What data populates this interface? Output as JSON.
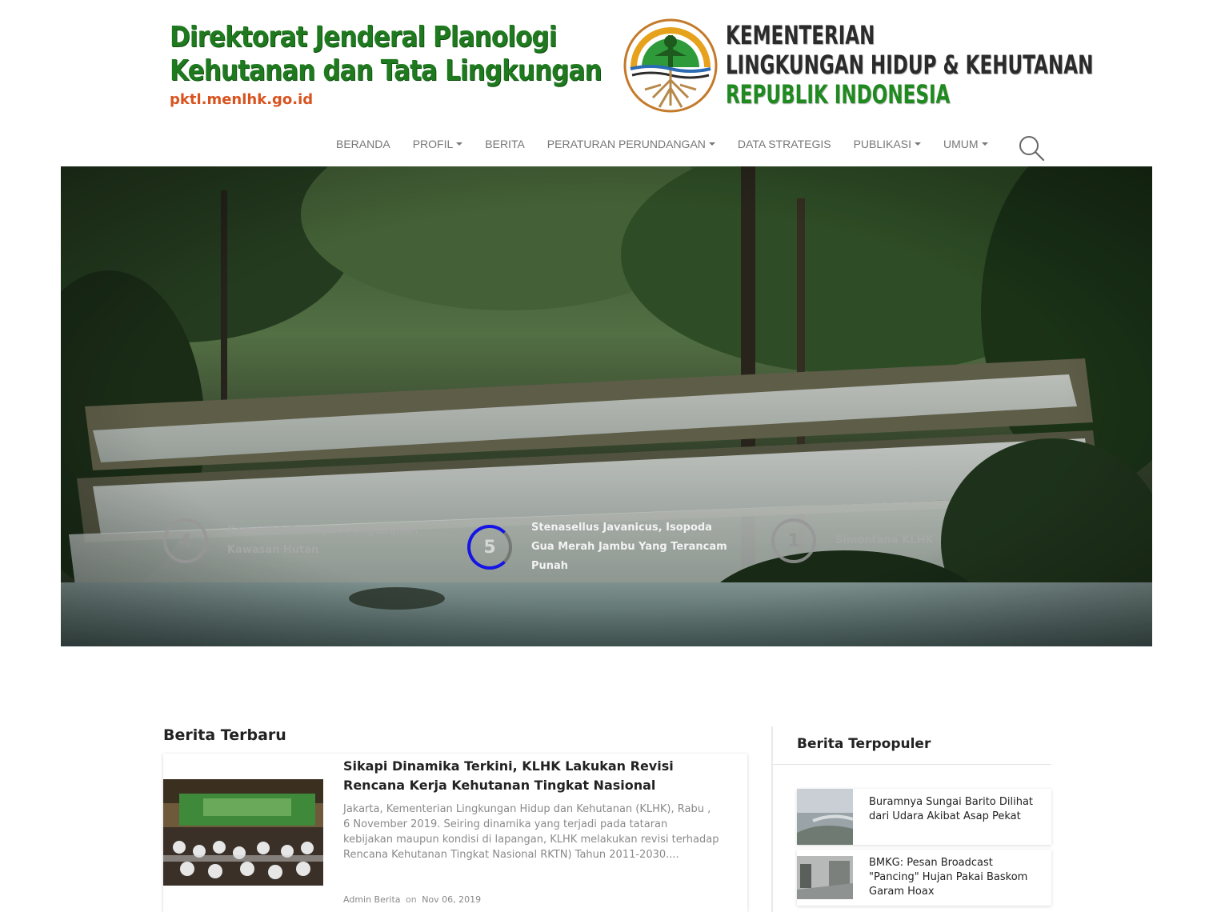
{
  "header": {
    "directorate_line1": "Direktorat Jenderal Planologi",
    "directorate_line2": "Kehutanan dan Tata Lingkungan",
    "directorate_url": "pktl.menlhk.go.id",
    "ministry_line1": "KEMENTERIAN",
    "ministry_line2": "LINGKUNGAN HIDUP & KEHUTANAN",
    "ministry_line3": "REPUBLIK INDONESIA"
  },
  "nav": {
    "items": [
      {
        "label": "BERANDA",
        "dropdown": false
      },
      {
        "label": "PROFIL",
        "dropdown": true
      },
      {
        "label": "BERITA",
        "dropdown": false
      },
      {
        "label": "PERATURAN PERUNDANGAN",
        "dropdown": true
      },
      {
        "label": "DATA STRATEGIS",
        "dropdown": false
      },
      {
        "label": "PUBLIKASI",
        "dropdown": true
      },
      {
        "label": "UMUM",
        "dropdown": true
      }
    ],
    "search_icon": "search-icon"
  },
  "slider": {
    "items": [
      {
        "number": "4",
        "title": "Kemenlhk Percepat Pengukuhan Kawasan Hutan",
        "active": false
      },
      {
        "number": "5",
        "title": "Stenasellus Javanicus, Isopoda Gua Merah Jambu Yang Terancam Punah",
        "active": true
      },
      {
        "number": "1",
        "title": "Simontana KLHK",
        "active": false
      }
    ],
    "active_color": "#1414e6"
  },
  "latest": {
    "heading": "Berita Terbaru",
    "article": {
      "title": "Sikapi Dinamika Terkini, KLHK Lakukan Revisi Rencana Kerja Kehutanan Tingkat Nasional",
      "excerpt": "Jakarta, Kementerian Lingkungan Hidup dan Kehutanan (KLHK), Rabu , 6 November 2019. Seiring dinamika yang terjadi pada tataran kebijakan maupun kondisi di lapangan, KLHK melakukan revisi terhadap Rencana Kehutanan Tingkat Nasional RKTN) Tahun 2011-2030....",
      "author": "Admin Berita",
      "on": "on",
      "date": "Nov 06, 2019"
    }
  },
  "popular": {
    "heading": "Berita Terpopuler",
    "items": [
      {
        "title": "Buramnya Sungai Barito Dilihat dari Udara Akibat Asap Pekat"
      },
      {
        "title": "BMKG: Pesan Broadcast \"Pancing\" Hujan Pakai Baskom Garam Hoax"
      }
    ]
  },
  "colors": {
    "brand_green": "#1f7a1f",
    "url_orange": "#d9531e",
    "nav_text": "#777777"
  }
}
